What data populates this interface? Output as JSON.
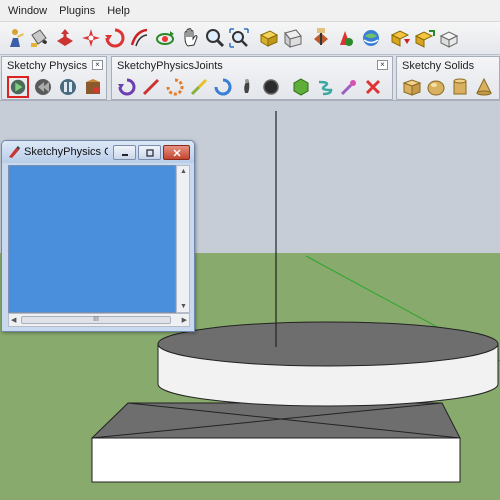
{
  "menubar": {
    "items": [
      {
        "label": "Window"
      },
      {
        "label": "Plugins"
      },
      {
        "label": "Help"
      }
    ]
  },
  "main_toolbar": {
    "icons": [
      "walk-icon",
      "paint-bucket-icon",
      "push-pull-icon",
      "follow-me-icon",
      "rotate-icon",
      "offset-icon",
      "orbit-icon",
      "pan-icon",
      "zoom-icon",
      "zoom-extents-icon",
      "move-icon",
      "top-view-icon",
      "section-plane-icon",
      "position-camera-icon",
      "look-around-icon",
      "get-models-icon",
      "share-model-icon",
      "components-icon"
    ]
  },
  "toolbars": {
    "physics": {
      "title": "Sketchy Physics",
      "buttons": [
        "play-icon",
        "rewind-icon",
        "pause-icon",
        "ui-editor-icon"
      ]
    },
    "joints": {
      "title": "SketchyPhysicsJoints",
      "buttons": [
        "hinge-joint-icon",
        "slider-joint-icon",
        "servo-joint-icon",
        "piston-joint-icon",
        "motor-joint-icon",
        "fixed-joint-icon",
        "gear-joint-icon",
        "ball-joint-icon",
        "spring-joint-icon",
        "magnet-joint-icon",
        "remove-joint-icon"
      ]
    },
    "solids": {
      "title": "Sketchy Solids",
      "buttons": [
        "box-solid-icon",
        "sphere-solid-icon",
        "cylinder-solid-icon",
        "cone-solid-icon"
      ]
    }
  },
  "console": {
    "title": "SketchyPhysics Co...",
    "scroll_thumb": "III",
    "content_color": "#4a8fdc"
  },
  "scene": {
    "sky_color": "#c6cdd6",
    "ground_color": "#88aa6d"
  }
}
